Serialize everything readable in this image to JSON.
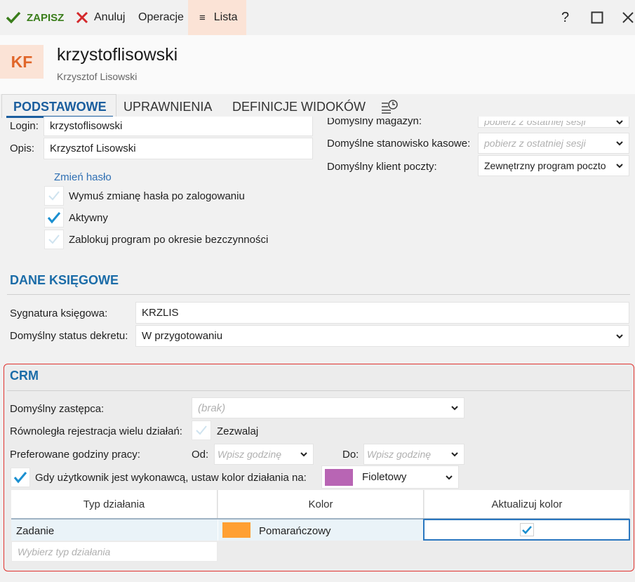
{
  "toolbar": {
    "save_label": "ZAPISZ",
    "cancel_label": "Anuluj",
    "operations_label": "Operacje",
    "list_label": "Lista",
    "help_label": "?"
  },
  "header": {
    "avatar_initials": "KF",
    "login": "krzystoflisowski",
    "full_name": "Krzysztof Lisowski"
  },
  "tabs": [
    {
      "label": "PODSTAWOWE",
      "active": true
    },
    {
      "label": "UPRAWNIENIA",
      "active": false
    },
    {
      "label": "DEFINICJE WIDOKÓW",
      "active": false
    }
  ],
  "basic": {
    "login_label": "Login:",
    "login_value": "krzystoflisowski",
    "desc_label": "Opis:",
    "desc_value": "Krzysztof Lisowski",
    "change_password_link": "Zmień hasło",
    "checkboxes": [
      {
        "label": "Wymuś zmianę hasła po zalogowaniu",
        "checked": false
      },
      {
        "label": "Aktywny",
        "checked": true
      },
      {
        "label": "Zablokuj program po okresie bezczynności",
        "checked": false
      }
    ]
  },
  "right": {
    "warehouse_label": "Domyślny magazyn:",
    "warehouse_placeholder": "pobierz z ostatniej sesji",
    "station_label": "Domyślne stanowisko kasowe:",
    "station_placeholder": "pobierz z ostatniej sesji",
    "mail_label": "Domyślny klient poczty:",
    "mail_value": "Zewnętrzny program poczto"
  },
  "accounting": {
    "title": "DANE KSIĘGOWE",
    "signature_label": "Sygnatura księgowa:",
    "signature_value": "KRZLIS",
    "status_label": "Domyślny status dekretu:",
    "status_value": "W przygotowaniu"
  },
  "crm": {
    "title": "CRM",
    "substitute_label": "Domyślny zastępca:",
    "substitute_placeholder": "(brak)",
    "parallel_label": "Równoległa rejestracja wielu działań:",
    "parallel_checkbox_label": "Zezwalaj",
    "parallel_checked": false,
    "hours_label": "Preferowane godziny pracy:",
    "from_label": "Od:",
    "from_placeholder": "Wpisz godzinę",
    "to_label": "Do:",
    "to_placeholder": "Wpisz godzinę",
    "color_rule_label": "Gdy użytkownik jest wykonawcą, ustaw kolor działania na:",
    "color_rule_checked": true,
    "color_rule_value": "Fioletowy",
    "color_rule_color": "#b865b4",
    "grid": {
      "columns": [
        "Typ działania",
        "Kolor",
        "Aktualizuj kolor"
      ],
      "rows": [
        {
          "type": "Zadanie",
          "color_name": "Pomarańczowy",
          "color": "#ffa033",
          "update": true
        }
      ],
      "new_row_placeholder": "Wybierz typ działania"
    }
  },
  "colors": {
    "accent": "#1b6ca8",
    "save_green": "#3a7d1b",
    "cancel_red": "#d4282b",
    "list_bg": "#fbe3d6",
    "crm_border": "#e0332f"
  }
}
